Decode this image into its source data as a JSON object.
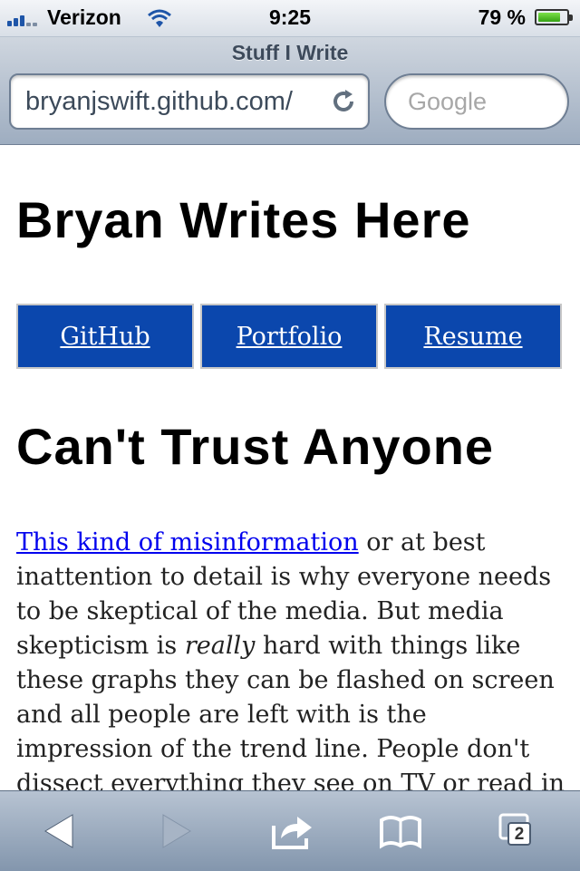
{
  "status_bar": {
    "carrier": "Verizon",
    "time": "9:25",
    "battery_text": "79 %",
    "battery_level": 0.79
  },
  "browser": {
    "page_title": "Stuff I Write",
    "url": "bryanjswift.github.com/",
    "search_placeholder": "Google"
  },
  "site": {
    "title": "Bryan Writes Here",
    "nav": [
      {
        "label": "GitHub"
      },
      {
        "label": "Portfolio"
      },
      {
        "label": "Resume"
      }
    ]
  },
  "post": {
    "title": "Can't Trust Anyone",
    "link_text": "This kind of misinformation",
    "text_1": " or at best inattention to detail is why everyone needs to be skeptical of the media. But media skepticism is ",
    "emphasis": "really",
    "text_2": " hard with things like these graphs they can be flashed on screen and all people are left with is the impression of the trend line. People don't dissect everything they see on TV or read in the"
  },
  "toolbar": {
    "tabs_count": "2"
  },
  "colors": {
    "nav_background": "#0b47ad",
    "link": "#0000ee"
  }
}
